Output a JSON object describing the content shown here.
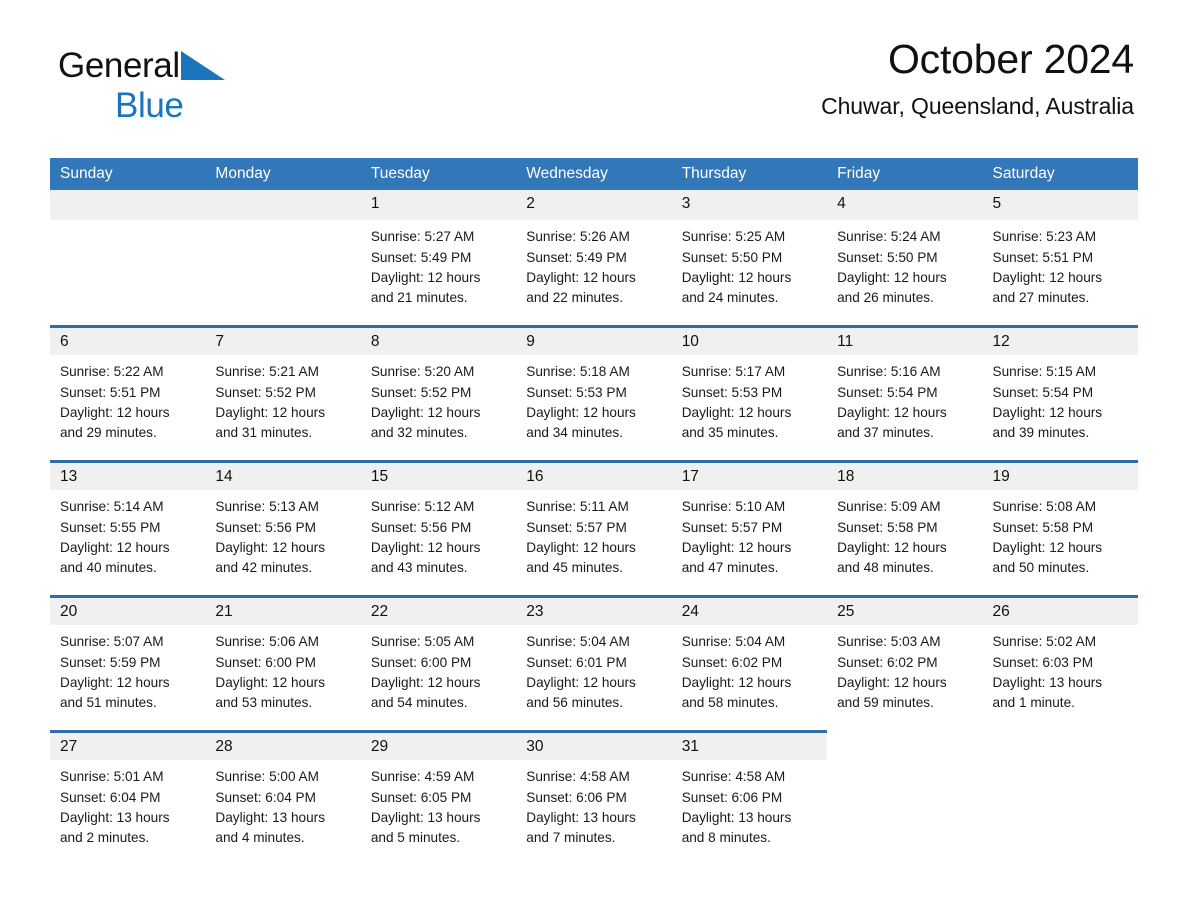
{
  "brand": {
    "name_part1": "General",
    "name_part2": "Blue",
    "flag_icon": "triangle-flag-icon",
    "accent_color": "#1b75bc"
  },
  "header": {
    "title": "October 2024",
    "location": "Chuwar, Queensland, Australia"
  },
  "theme": {
    "header_row_color": "#3277b8",
    "row_rule_color": "#2e6da8",
    "daynum_strip_color": "#f0f0f0"
  },
  "weekdays": [
    "Sunday",
    "Monday",
    "Tuesday",
    "Wednesday",
    "Thursday",
    "Friday",
    "Saturday"
  ],
  "weeks": [
    [
      {
        "day": "",
        "lines": []
      },
      {
        "day": "",
        "lines": []
      },
      {
        "day": "1",
        "lines": [
          "Sunrise: 5:27 AM",
          "Sunset: 5:49 PM",
          "Daylight: 12 hours",
          "and 21 minutes."
        ]
      },
      {
        "day": "2",
        "lines": [
          "Sunrise: 5:26 AM",
          "Sunset: 5:49 PM",
          "Daylight: 12 hours",
          "and 22 minutes."
        ]
      },
      {
        "day": "3",
        "lines": [
          "Sunrise: 5:25 AM",
          "Sunset: 5:50 PM",
          "Daylight: 12 hours",
          "and 24 minutes."
        ]
      },
      {
        "day": "4",
        "lines": [
          "Sunrise: 5:24 AM",
          "Sunset: 5:50 PM",
          "Daylight: 12 hours",
          "and 26 minutes."
        ]
      },
      {
        "day": "5",
        "lines": [
          "Sunrise: 5:23 AM",
          "Sunset: 5:51 PM",
          "Daylight: 12 hours",
          "and 27 minutes."
        ]
      }
    ],
    [
      {
        "day": "6",
        "lines": [
          "Sunrise: 5:22 AM",
          "Sunset: 5:51 PM",
          "Daylight: 12 hours",
          "and 29 minutes."
        ]
      },
      {
        "day": "7",
        "lines": [
          "Sunrise: 5:21 AM",
          "Sunset: 5:52 PM",
          "Daylight: 12 hours",
          "and 31 minutes."
        ]
      },
      {
        "day": "8",
        "lines": [
          "Sunrise: 5:20 AM",
          "Sunset: 5:52 PM",
          "Daylight: 12 hours",
          "and 32 minutes."
        ]
      },
      {
        "day": "9",
        "lines": [
          "Sunrise: 5:18 AM",
          "Sunset: 5:53 PM",
          "Daylight: 12 hours",
          "and 34 minutes."
        ]
      },
      {
        "day": "10",
        "lines": [
          "Sunrise: 5:17 AM",
          "Sunset: 5:53 PM",
          "Daylight: 12 hours",
          "and 35 minutes."
        ]
      },
      {
        "day": "11",
        "lines": [
          "Sunrise: 5:16 AM",
          "Sunset: 5:54 PM",
          "Daylight: 12 hours",
          "and 37 minutes."
        ]
      },
      {
        "day": "12",
        "lines": [
          "Sunrise: 5:15 AM",
          "Sunset: 5:54 PM",
          "Daylight: 12 hours",
          "and 39 minutes."
        ]
      }
    ],
    [
      {
        "day": "13",
        "lines": [
          "Sunrise: 5:14 AM",
          "Sunset: 5:55 PM",
          "Daylight: 12 hours",
          "and 40 minutes."
        ]
      },
      {
        "day": "14",
        "lines": [
          "Sunrise: 5:13 AM",
          "Sunset: 5:56 PM",
          "Daylight: 12 hours",
          "and 42 minutes."
        ]
      },
      {
        "day": "15",
        "lines": [
          "Sunrise: 5:12 AM",
          "Sunset: 5:56 PM",
          "Daylight: 12 hours",
          "and 43 minutes."
        ]
      },
      {
        "day": "16",
        "lines": [
          "Sunrise: 5:11 AM",
          "Sunset: 5:57 PM",
          "Daylight: 12 hours",
          "and 45 minutes."
        ]
      },
      {
        "day": "17",
        "lines": [
          "Sunrise: 5:10 AM",
          "Sunset: 5:57 PM",
          "Daylight: 12 hours",
          "and 47 minutes."
        ]
      },
      {
        "day": "18",
        "lines": [
          "Sunrise: 5:09 AM",
          "Sunset: 5:58 PM",
          "Daylight: 12 hours",
          "and 48 minutes."
        ]
      },
      {
        "day": "19",
        "lines": [
          "Sunrise: 5:08 AM",
          "Sunset: 5:58 PM",
          "Daylight: 12 hours",
          "and 50 minutes."
        ]
      }
    ],
    [
      {
        "day": "20",
        "lines": [
          "Sunrise: 5:07 AM",
          "Sunset: 5:59 PM",
          "Daylight: 12 hours",
          "and 51 minutes."
        ]
      },
      {
        "day": "21",
        "lines": [
          "Sunrise: 5:06 AM",
          "Sunset: 6:00 PM",
          "Daylight: 12 hours",
          "and 53 minutes."
        ]
      },
      {
        "day": "22",
        "lines": [
          "Sunrise: 5:05 AM",
          "Sunset: 6:00 PM",
          "Daylight: 12 hours",
          "and 54 minutes."
        ]
      },
      {
        "day": "23",
        "lines": [
          "Sunrise: 5:04 AM",
          "Sunset: 6:01 PM",
          "Daylight: 12 hours",
          "and 56 minutes."
        ]
      },
      {
        "day": "24",
        "lines": [
          "Sunrise: 5:04 AM",
          "Sunset: 6:02 PM",
          "Daylight: 12 hours",
          "and 58 minutes."
        ]
      },
      {
        "day": "25",
        "lines": [
          "Sunrise: 5:03 AM",
          "Sunset: 6:02 PM",
          "Daylight: 12 hours",
          "and 59 minutes."
        ]
      },
      {
        "day": "26",
        "lines": [
          "Sunrise: 5:02 AM",
          "Sunset: 6:03 PM",
          "Daylight: 13 hours",
          "and 1 minute."
        ]
      }
    ],
    [
      {
        "day": "27",
        "lines": [
          "Sunrise: 5:01 AM",
          "Sunset: 6:04 PM",
          "Daylight: 13 hours",
          "and 2 minutes."
        ]
      },
      {
        "day": "28",
        "lines": [
          "Sunrise: 5:00 AM",
          "Sunset: 6:04 PM",
          "Daylight: 13 hours",
          "and 4 minutes."
        ]
      },
      {
        "day": "29",
        "lines": [
          "Sunrise: 4:59 AM",
          "Sunset: 6:05 PM",
          "Daylight: 13 hours",
          "and 5 minutes."
        ]
      },
      {
        "day": "30",
        "lines": [
          "Sunrise: 4:58 AM",
          "Sunset: 6:06 PM",
          "Daylight: 13 hours",
          "and 7 minutes."
        ]
      },
      {
        "day": "31",
        "lines": [
          "Sunrise: 4:58 AM",
          "Sunset: 6:06 PM",
          "Daylight: 13 hours",
          "and 8 minutes."
        ]
      },
      {
        "day": "",
        "lines": []
      },
      {
        "day": "",
        "lines": []
      }
    ]
  ]
}
